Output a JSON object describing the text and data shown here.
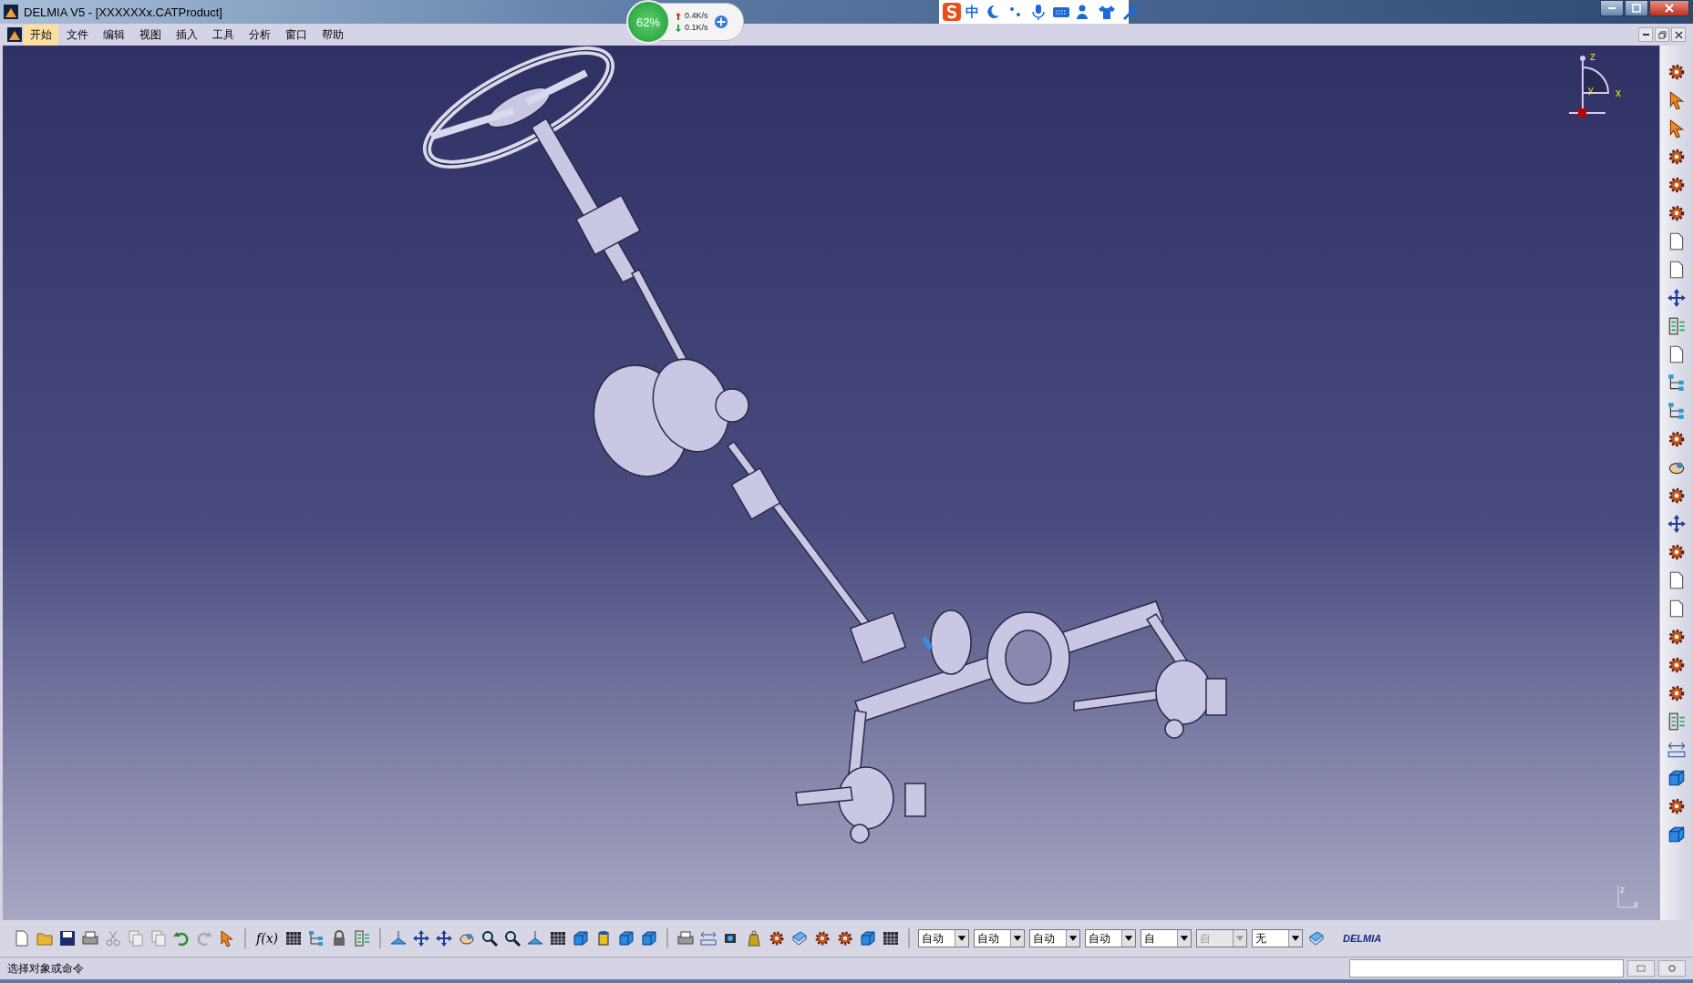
{
  "window": {
    "title": "DELMIA V5 - [XXXXXXx.CATProduct]"
  },
  "menu": [
    {
      "label": "开始",
      "selected": true
    },
    {
      "label": "文件",
      "selected": false
    },
    {
      "label": "编辑",
      "selected": false
    },
    {
      "label": "视图",
      "selected": false
    },
    {
      "label": "插入",
      "selected": false
    },
    {
      "label": "工具",
      "selected": false
    },
    {
      "label": "分析",
      "selected": false
    },
    {
      "label": "窗口",
      "selected": false
    },
    {
      "label": "帮助",
      "selected": false
    }
  ],
  "network_widget": {
    "usage": "62%",
    "upload": "0.4K/s",
    "download": "0.1K/s"
  },
  "ime_bar": {
    "mode": "中"
  },
  "compass": {
    "z": "z",
    "x": "x",
    "y": "y"
  },
  "mini_axis": {
    "z": "z",
    "x": "x"
  },
  "formula_button": "f(x)",
  "dropdowns": [
    {
      "value": "自动",
      "disabled": false
    },
    {
      "value": "自动",
      "disabled": false
    },
    {
      "value": "自动",
      "disabled": false
    },
    {
      "value": "自动",
      "disabled": false
    },
    {
      "value": "自",
      "disabled": false
    },
    {
      "value": "自",
      "disabled": true
    },
    {
      "value": "无",
      "disabled": false
    }
  ],
  "brand": "DELMIA",
  "status_bar": {
    "prompt": "选择对象或命令"
  }
}
